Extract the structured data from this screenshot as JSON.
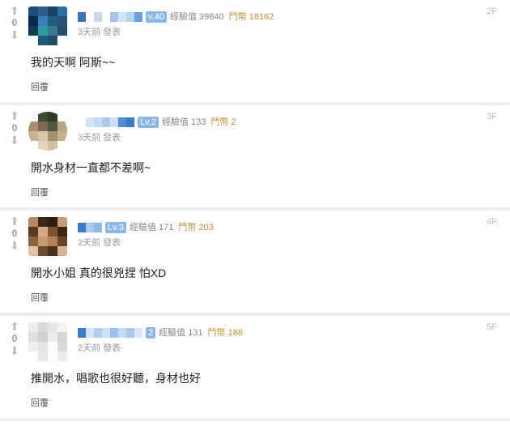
{
  "comments": [
    {
      "floor": "2F",
      "vote_count": "0",
      "level": "v.40",
      "exp_label": "經驗值",
      "exp": "39840",
      "gp_label": "鬥幣",
      "gp": "16162",
      "time": "3天前 發表",
      "body": "我的天啊 阿斯~~",
      "reply": "回覆"
    },
    {
      "floor": "3F",
      "vote_count": "0",
      "level": "Lv.2",
      "exp_label": "經驗值",
      "exp": "133",
      "gp_label": "鬥幣",
      "gp": "2",
      "time": "3天前 發表",
      "body": "開水身材一直都不差啊~",
      "reply": "回覆"
    },
    {
      "floor": "4F",
      "vote_count": "0",
      "level": "Lv.3",
      "exp_label": "經驗值",
      "exp": "171",
      "gp_label": "鬥幣",
      "gp": "203",
      "time": "2天前 發表",
      "body": "開水小姐 真的很兇捏 怕XD",
      "reply": "回覆"
    },
    {
      "floor": "5F",
      "vote_count": "0",
      "level": "2",
      "exp_label": "經驗值",
      "exp": "131",
      "gp_label": "鬥幣",
      "gp": "188",
      "time": "2天前 發表",
      "body": "推開水，唱歌也很好聽，身材也好",
      "reply": "回覆"
    }
  ]
}
